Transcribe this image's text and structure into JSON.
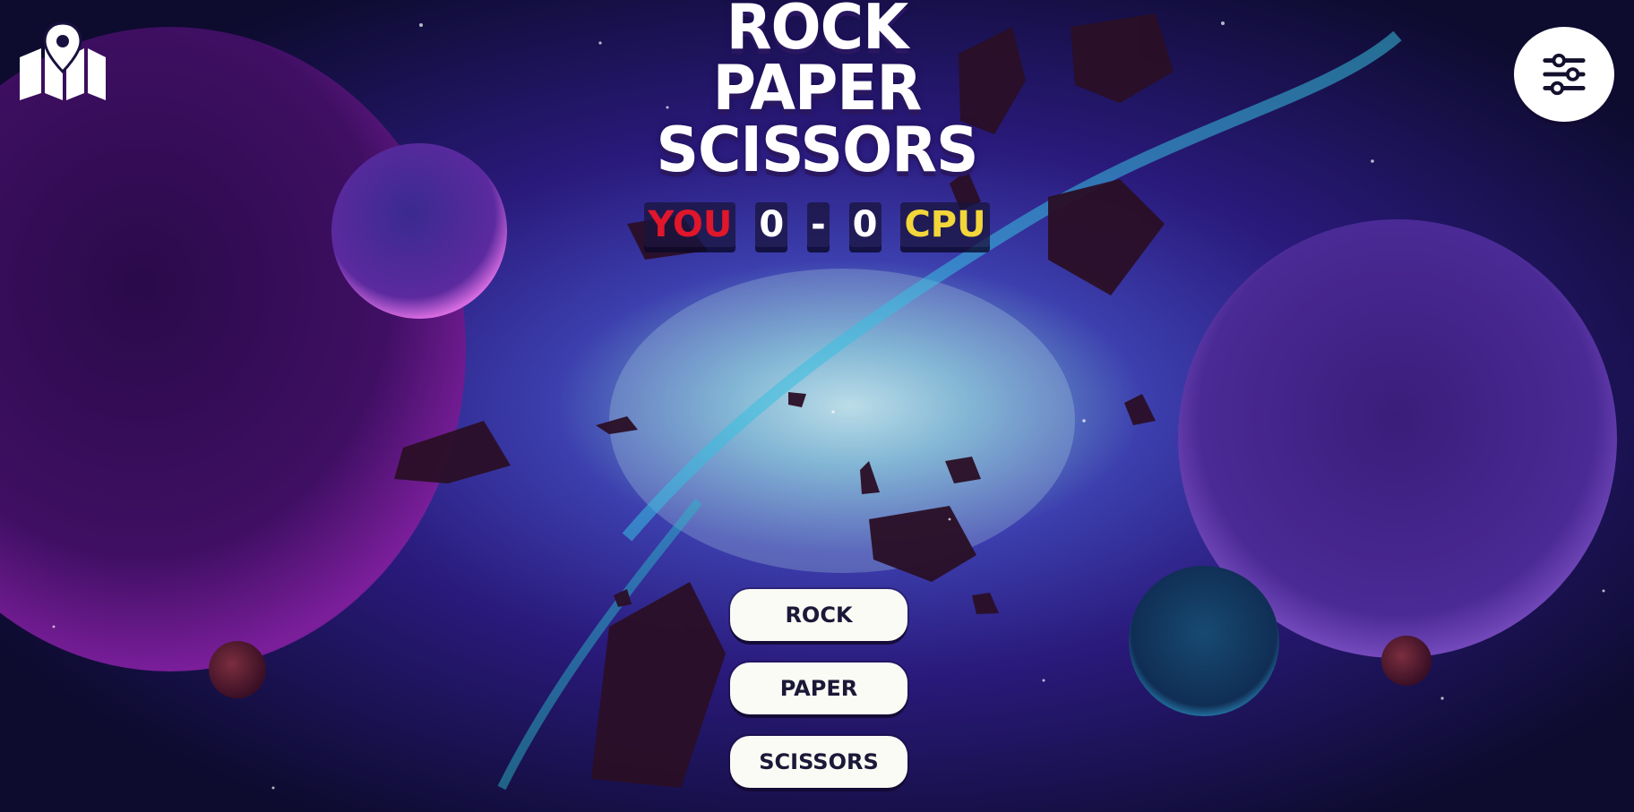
{
  "title": {
    "line1": "ROCK",
    "line2": "PAPER",
    "line3": "SCISSORS"
  },
  "score": {
    "you_label": "YOU",
    "player_score": "0",
    "separator": "-",
    "cpu_score": "0",
    "cpu_label": "CPU"
  },
  "choices": {
    "rock": "ROCK",
    "paper": "PAPER",
    "scissors": "SCISSORS"
  },
  "icons": {
    "top_left": "map-icon",
    "top_right": "settings-sliders-icon"
  },
  "colors": {
    "you": "#e0162b",
    "cpu": "#f2d63a",
    "button_bg": "#fbfbf5",
    "button_text": "#1b1838"
  }
}
